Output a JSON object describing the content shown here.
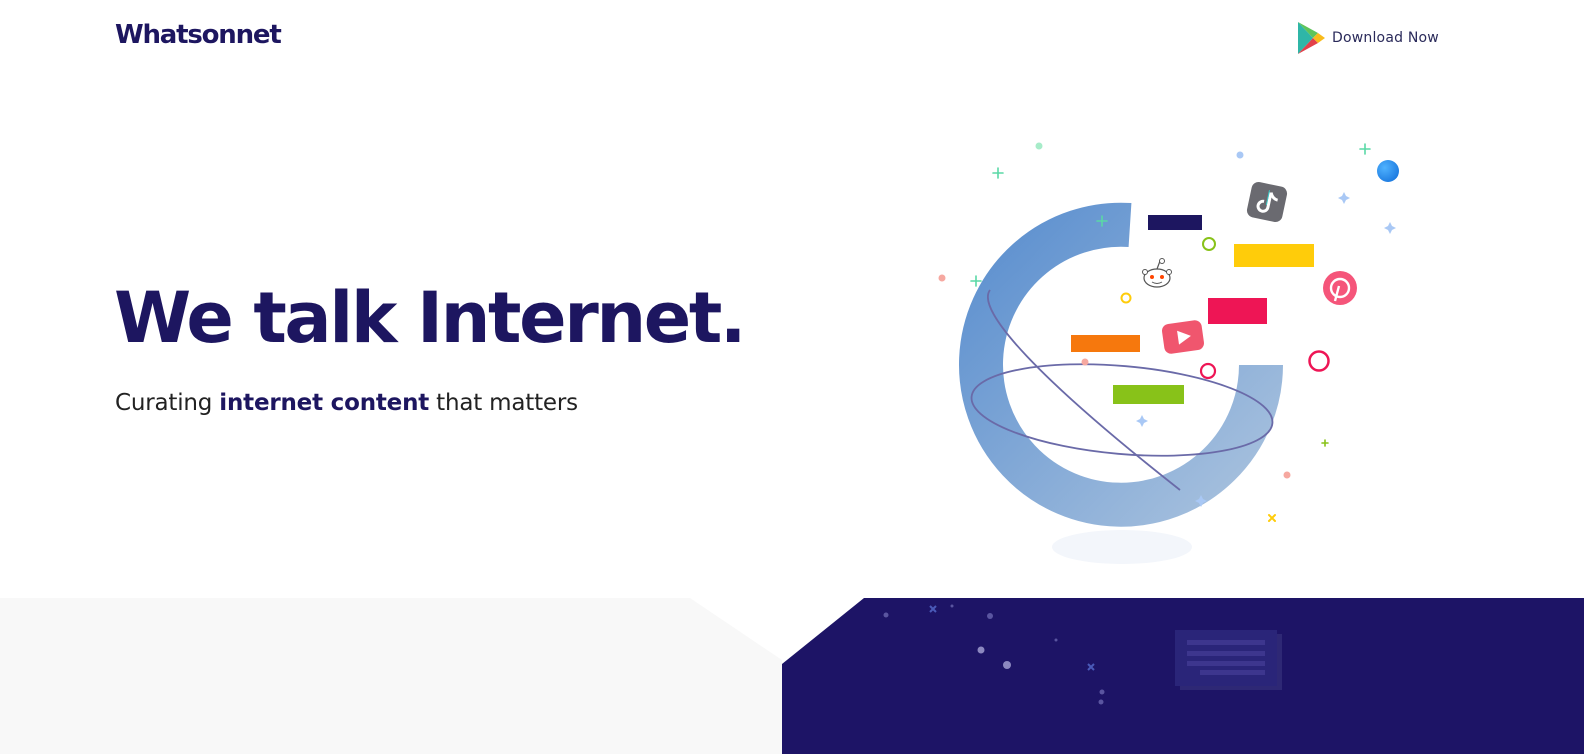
{
  "header": {
    "logo_text": "Whatsonnet",
    "download_label": "Download Now",
    "download_icon": "google-play-icon"
  },
  "hero": {
    "title": "We talk Internet.",
    "subtitle_prefix": "Curating ",
    "subtitle_emphasis": "internet content",
    "subtitle_suffix": " that matters"
  },
  "illustration": {
    "icons": [
      "tiktok-icon",
      "reddit-icon",
      "youtube-icon",
      "pinterest-icon"
    ]
  },
  "colors": {
    "brand_navy": "#1d1660",
    "ring_blue": "#5b8fcf",
    "bar_yellow": "#ffcc0a",
    "bar_red": "#ee1555",
    "bar_orange": "#f6780d",
    "bar_green": "#88c219",
    "light_gray_band": "#f8f8f8"
  }
}
